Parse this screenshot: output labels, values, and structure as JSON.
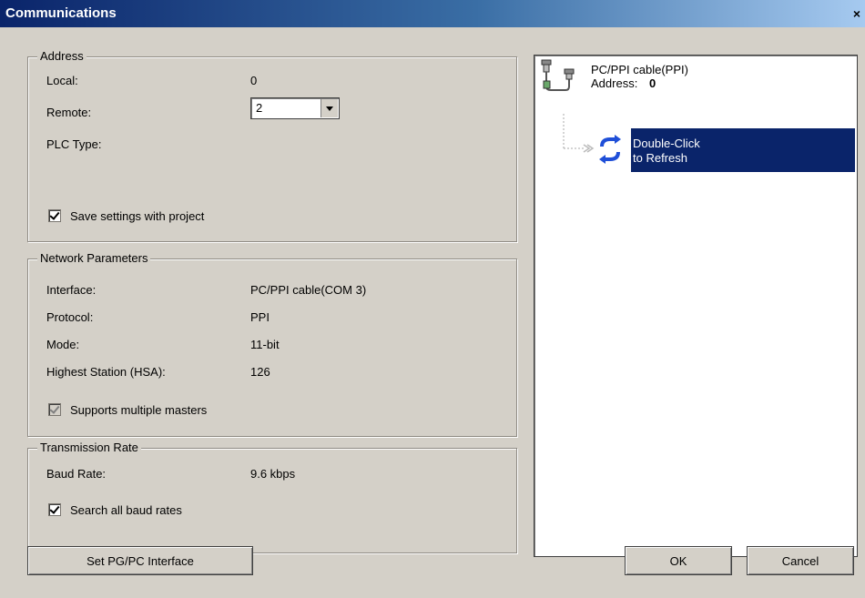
{
  "window": {
    "title": "Communications",
    "close_glyph": "×"
  },
  "address": {
    "legend": "Address",
    "local_label": "Local:",
    "local_value": "0",
    "remote_label": "Remote:",
    "remote_value": "2",
    "plc_type_label": "PLC Type:",
    "save_settings_label": "Save settings with project",
    "save_settings_checked": true
  },
  "network": {
    "legend": "Network Parameters",
    "interface_label": "Interface:",
    "interface_value": "PC/PPI cable(COM 3)",
    "protocol_label": "Protocol:",
    "protocol_value": "PPI",
    "mode_label": "Mode:",
    "mode_value": "11-bit",
    "hsa_label": "Highest Station (HSA):",
    "hsa_value": "126",
    "multiple_masters_label": "Supports multiple masters",
    "multiple_masters_checked": true,
    "multiple_masters_disabled": true
  },
  "transmission": {
    "legend": "Transmission Rate",
    "baud_rate_label": "Baud Rate:",
    "baud_rate_value": "9.6 kbps",
    "search_all_label": "Search all baud rates",
    "search_all_checked": true
  },
  "tree": {
    "cable_name": "PC/PPI cable(PPI)",
    "address_label": "Address:",
    "address_value": "0",
    "refresh_line1": "Double-Click",
    "refresh_line2": "to Refresh",
    "cable_icon": "cable-connector-icon",
    "refresh_icon": "refresh-icon"
  },
  "buttons": {
    "set_interface": "Set PG/PC Interface",
    "ok": "OK",
    "cancel": "Cancel"
  },
  "colors": {
    "selection": "#0a246a",
    "refresh_icon": "#1f4fd8",
    "dialog_bg": "#d4d0c8"
  }
}
